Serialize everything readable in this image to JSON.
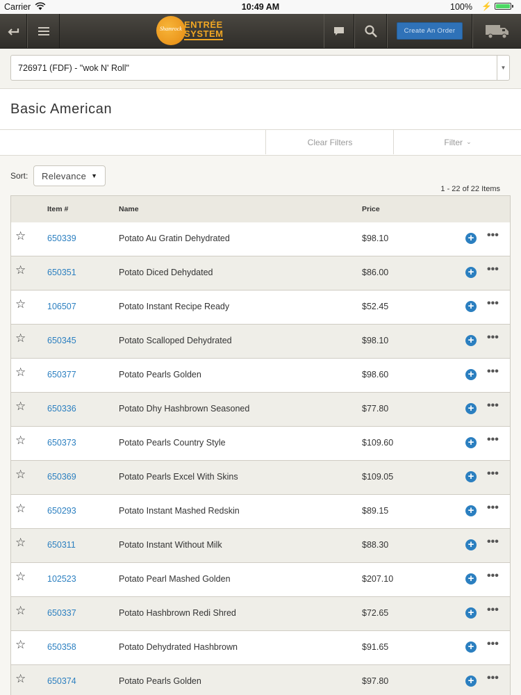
{
  "status_bar": {
    "carrier": "Carrier",
    "time": "10:49 AM",
    "battery": "100%"
  },
  "header": {
    "logo_text_top": "ENTRÉE",
    "logo_text_bottom": "SYSTEM",
    "logo_script": "Shamrock",
    "create_order_label": "Create An Order",
    "icons": [
      "back-icon",
      "menu-icon",
      "chat-icon",
      "search-icon",
      "truck-icon"
    ]
  },
  "account": {
    "selected": "726971 (FDF) - \"wok N' Roll\""
  },
  "page": {
    "title": "Basic American"
  },
  "filters": {
    "clear_label": "Clear Filters",
    "filter_label": "Filter"
  },
  "sort": {
    "label": "Sort:",
    "selected": "Relevance"
  },
  "results_count": "1 - 22 of 22 Items",
  "table": {
    "columns": [
      "Item #",
      "Name",
      "Price"
    ],
    "rows": [
      {
        "item": "650339",
        "name": "Potato Au Gratin Dehydrated",
        "price": "$98.10"
      },
      {
        "item": "650351",
        "name": "Potato Diced Dehydated",
        "price": "$86.00"
      },
      {
        "item": "106507",
        "name": "Potato Instant Recipe Ready",
        "price": "$52.45"
      },
      {
        "item": "650345",
        "name": "Potato Scalloped Dehydrated",
        "price": "$98.10"
      },
      {
        "item": "650377",
        "name": "Potato Pearls Golden",
        "price": "$98.60"
      },
      {
        "item": "650336",
        "name": "Potato Dhy Hashbrown Seasoned",
        "price": "$77.80"
      },
      {
        "item": "650373",
        "name": "Potato Pearls Country Style",
        "price": "$109.60"
      },
      {
        "item": "650369",
        "name": "Potato Pearls Excel With Skins",
        "price": "$109.05"
      },
      {
        "item": "650293",
        "name": "Potato Instant Mashed Redskin",
        "price": "$89.15"
      },
      {
        "item": "650311",
        "name": "Potato Instant Without Milk",
        "price": "$88.30"
      },
      {
        "item": "102523",
        "name": "Potato Pearl Mashed Golden",
        "price": "$207.10"
      },
      {
        "item": "650337",
        "name": "Potato Hashbrown Redi Shred",
        "price": "$72.65"
      },
      {
        "item": "650358",
        "name": "Potato Dehydrated Hashbrown",
        "price": "$91.65"
      },
      {
        "item": "650374",
        "name": "Potato Pearls Golden",
        "price": "$97.80"
      }
    ]
  },
  "colors": {
    "accent": "#2b7fc0",
    "header_bg": "#3a3833",
    "logo_orange": "#f0a623",
    "row_alt": "#efeee8"
  }
}
